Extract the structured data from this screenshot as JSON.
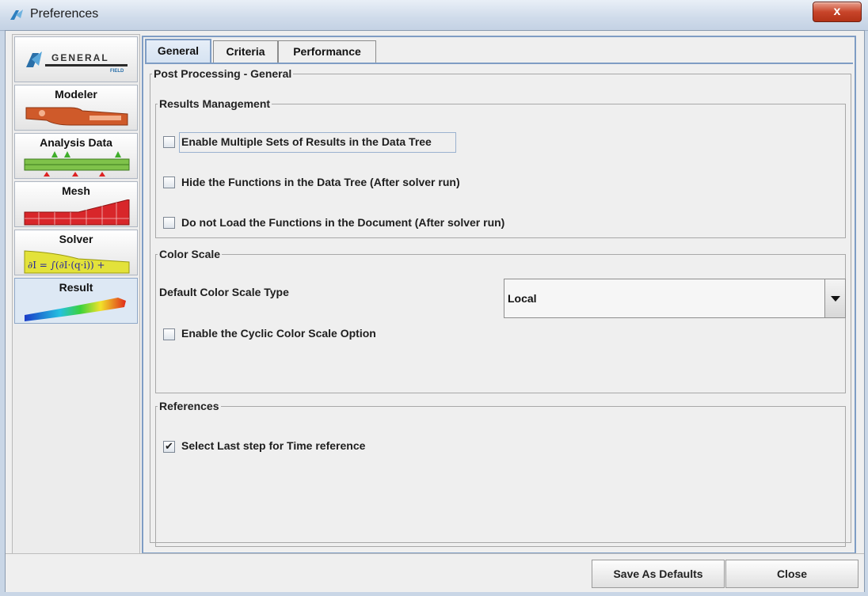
{
  "window": {
    "title": "Preferences",
    "close_label": "x"
  },
  "categories": [
    {
      "label": "GENERAL",
      "sublabel": "FIELD",
      "icon": "general-logo-icon"
    },
    {
      "label": "Modeler",
      "icon": "modeler-part-icon"
    },
    {
      "label": "Analysis Data",
      "icon": "analysis-data-loads-icon"
    },
    {
      "label": "Mesh",
      "icon": "mesh-icon"
    },
    {
      "label": "Solver",
      "icon": "solver-equation-icon"
    },
    {
      "label": "Result",
      "icon": "result-contour-icon",
      "selected": true
    }
  ],
  "solver_formula": "∂I = ∫(∂I·(q·i)) +",
  "tabs": [
    {
      "label": "General",
      "active": true
    },
    {
      "label": "Criteria",
      "active": false
    },
    {
      "label": "Performance",
      "active": false
    }
  ],
  "post_processing": {
    "title": "Post Processing - General",
    "results_management": {
      "title": "Results Management",
      "options": [
        {
          "label": "Enable Multiple Sets of Results in the Data Tree",
          "checked": false
        },
        {
          "label": "Hide the Functions in the Data Tree (After solver run)",
          "checked": false
        },
        {
          "label": "Do not Load the Functions in the Document (After solver run)",
          "checked": false
        }
      ]
    },
    "color_scale": {
      "title": "Color Scale",
      "type_label": "Default Color Scale Type",
      "type_value": "Local",
      "cyclic_label": "Enable the Cyclic Color Scale Option",
      "cyclic_checked": false
    },
    "references": {
      "title": "References",
      "last_step_label": "Select Last step for Time reference",
      "last_step_checked": true
    }
  },
  "buttons": {
    "save_defaults": "Save As Defaults",
    "close": "Close"
  },
  "colors": {
    "accent_border": "#7f9dc4",
    "close_button": "#c8452a"
  }
}
